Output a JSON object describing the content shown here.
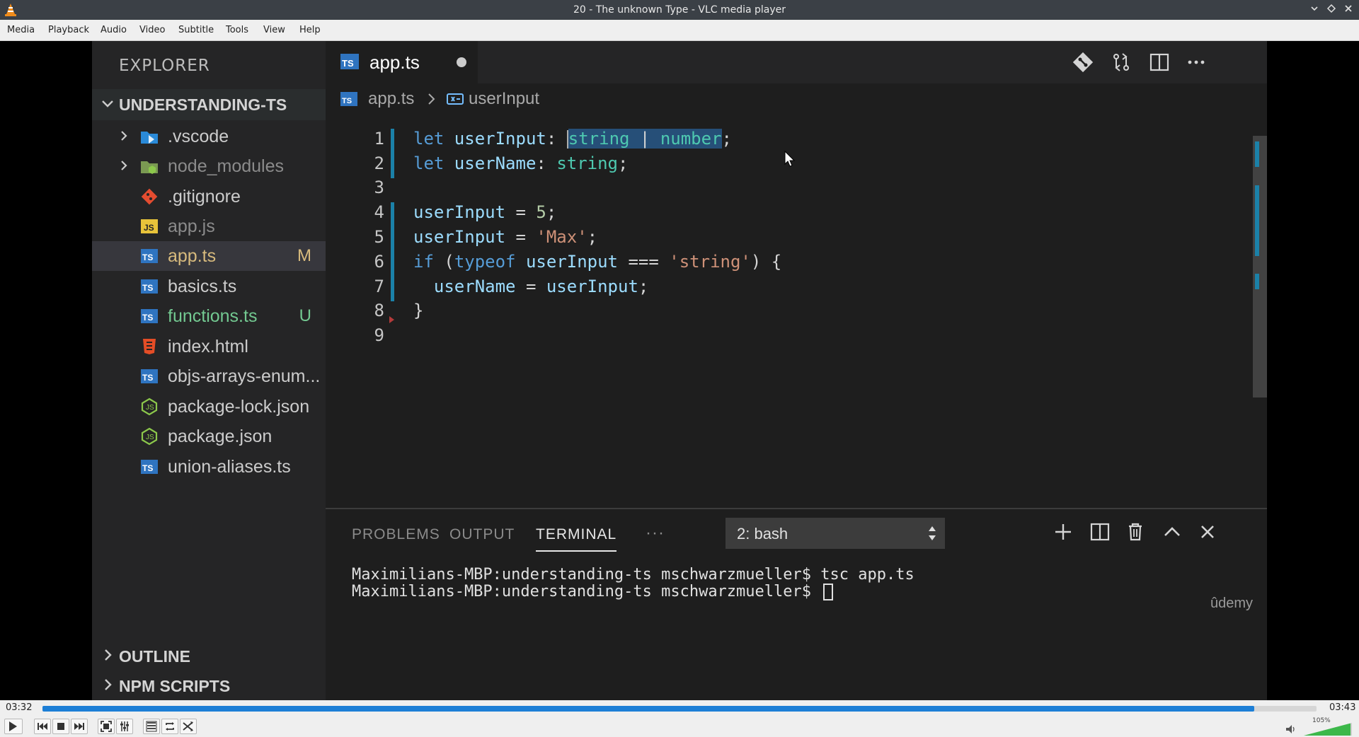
{
  "window": {
    "title": "20 - The unknown Type - VLC media player"
  },
  "menu": [
    "Media",
    "Playback",
    "Audio",
    "Video",
    "Subtitle",
    "Tools",
    "View",
    "Help"
  ],
  "explorer": {
    "heading": "EXPLORER",
    "project": "UNDERSTANDING-TS",
    "items": [
      {
        "name": ".vscode",
        "icon": "vscode-folder-icon",
        "folder": true,
        "badge": ""
      },
      {
        "name": "node_modules",
        "icon": "node-folder-icon",
        "folder": true,
        "badge": ""
      },
      {
        "name": ".gitignore",
        "icon": "git-icon",
        "folder": false,
        "badge": ""
      },
      {
        "name": "app.js",
        "icon": "js-file-icon",
        "folder": false,
        "badge": ""
      },
      {
        "name": "app.ts",
        "icon": "ts-file-icon",
        "folder": false,
        "badge": "M"
      },
      {
        "name": "basics.ts",
        "icon": "ts-file-icon",
        "folder": false,
        "badge": ""
      },
      {
        "name": "functions.ts",
        "icon": "ts-file-icon",
        "folder": false,
        "badge": "U"
      },
      {
        "name": "index.html",
        "icon": "html-file-icon",
        "folder": false,
        "badge": ""
      },
      {
        "name": "objs-arrays-enum...",
        "icon": "ts-file-icon",
        "folder": false,
        "badge": ""
      },
      {
        "name": "package-lock.json",
        "icon": "json-file-icon",
        "folder": false,
        "badge": ""
      },
      {
        "name": "package.json",
        "icon": "json-file-icon",
        "folder": false,
        "badge": ""
      },
      {
        "name": "union-aliases.ts",
        "icon": "ts-file-icon",
        "folder": false,
        "badge": ""
      }
    ],
    "outline": "OUTLINE",
    "npm_scripts": "NPM SCRIPTS"
  },
  "editor": {
    "tab": "app.ts",
    "breadcrumb_file": "app.ts",
    "breadcrumb_symbol": "userInput",
    "line_numbers": [
      "1",
      "2",
      "3",
      "4",
      "5",
      "6",
      "7",
      "8",
      "9"
    ]
  },
  "panel": {
    "tabs": [
      "PROBLEMS",
      "OUTPUT",
      "TERMINAL"
    ],
    "more": "···",
    "terminal_select": "2: bash",
    "lines": [
      "Maximilians-MBP:understanding-ts mschwarzmueller$ tsc app.ts",
      "Maximilians-MBP:understanding-ts mschwarzmueller$ "
    ],
    "watermark": "ûdemy"
  },
  "player": {
    "elapsed": "03:32",
    "total": "03:43",
    "progress": 0.951,
    "volume_label": "105%"
  },
  "colors": {
    "accent": "#1d7fd6",
    "editor_bg": "#1e1e1e",
    "sidebar_bg": "#252526",
    "ts_blue": "#2f74c0",
    "modified": "#d7ba7d",
    "untracked": "#73c991"
  }
}
